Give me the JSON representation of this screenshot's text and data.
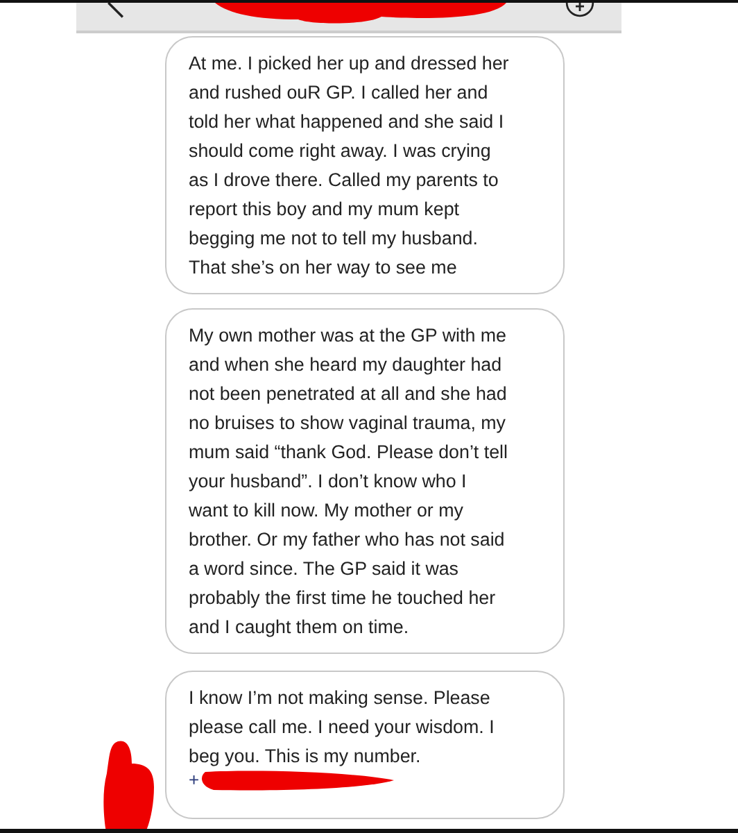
{
  "header": {
    "kind": "chat"
  },
  "messages": [
    {
      "text": "At me. I picked her up and dressed her and rushed ouR GP. I called her and told her what happened and she said I should come right away. I was crying as I drove there. Called my parents to report this boy and my mum kept begging me not to tell my husband. That she’s on her way to see me"
    },
    {
      "text": "My own mother was at the GP with me and when she heard my daughter had not been penetrated at all and she had no bruises to show vaginal trauma, my mum said “thank God. Please don’t tell your husband”. I don’t know who I want to kill now. My mother or my brother. Or my father who has not said a word since. The GP said it was probably the first time he touched her and I caught them on time."
    },
    {
      "text": "I know I’m not making sense. Please please call me. I need your wisdom. I beg you. This is my number.",
      "phone": "+"
    }
  ]
}
